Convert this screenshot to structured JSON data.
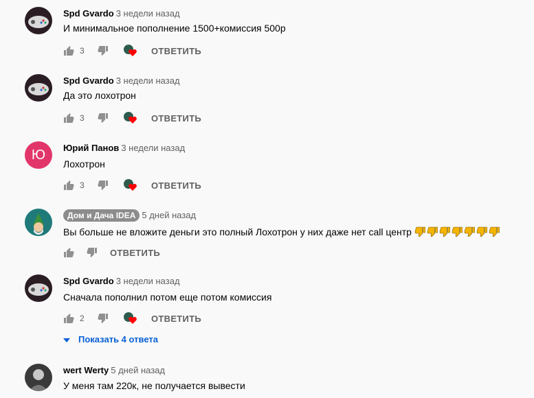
{
  "comments": [
    {
      "author": "Spd Gvardo",
      "time": "3 недели назад",
      "text": "И минимальное пополнение 1500+комиссия 500р",
      "likes": "3",
      "reply_label": "ОТВЕТИТЬ",
      "avatar": "gamepad-avatar"
    },
    {
      "author": "Spd Gvardo",
      "time": "3 недели назад",
      "text": "Да это лохотрон",
      "likes": "3",
      "reply_label": "ОТВЕТИТЬ",
      "avatar": "gamepad-avatar"
    },
    {
      "author": "Юрий Панов",
      "time": "3 недели назад",
      "text": "Лохотрон",
      "likes": "3",
      "reply_label": "ОТВЕТИТЬ",
      "avatar_letter": "Ю",
      "avatar_color": "#e2366b"
    },
    {
      "author": "Дом и Дача IDEA",
      "time": "5 дней назад",
      "text": "Вы больше не вложите деньги это полный Лохотрон у них даже нет call центр",
      "reply_label": "ОТВЕТИТЬ",
      "avatar": "gnome-avatar",
      "emoji": "thumbs-down-emoji",
      "emoji_count": 7
    },
    {
      "author": "Spd Gvardo",
      "time": "3 недели назад",
      "text": "Сначала пополнил потом еще потом комиссия",
      "likes": "2",
      "reply_label": "ОТВЕТИТЬ",
      "avatar": "gamepad-avatar",
      "show_replies": "Показать 4 ответа"
    },
    {
      "author": "wert Werty",
      "time": "5 дней назад",
      "text": "У меня там 220к, не получается вывести",
      "avatar": "dark-avatar"
    }
  ],
  "colors": {
    "link": "#065fd4",
    "heart": "#ff0000",
    "emoji": "#f5b400"
  }
}
